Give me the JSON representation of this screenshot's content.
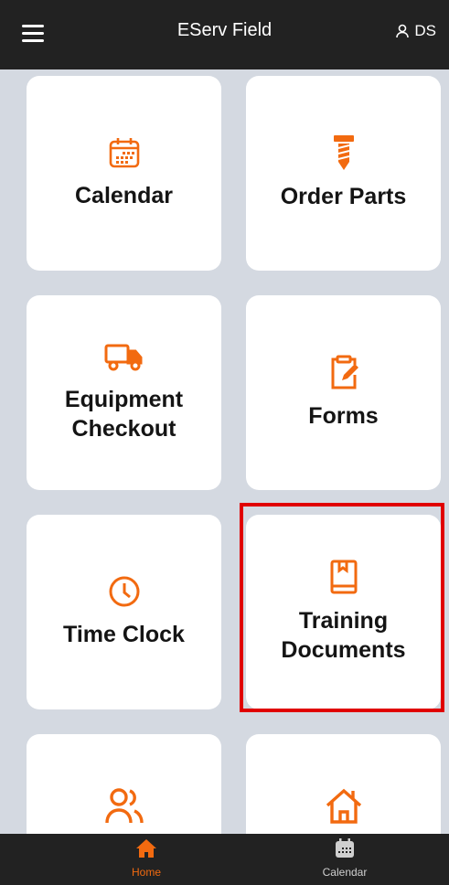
{
  "header": {
    "title": "EServ Field",
    "user_initials": "DS"
  },
  "tiles": [
    {
      "label": "Calendar",
      "icon": "calendar-icon"
    },
    {
      "label": "Order Parts",
      "icon": "screw-icon"
    },
    {
      "label": "Equipment Checkout",
      "icon": "truck-icon"
    },
    {
      "label": "Forms",
      "icon": "clipboard-edit-icon"
    },
    {
      "label": "Time Clock",
      "icon": "clock-icon"
    },
    {
      "label": "Training Documents",
      "icon": "book-icon"
    },
    {
      "label": "",
      "icon": "users-icon"
    },
    {
      "label": "",
      "icon": "home-outline-icon"
    }
  ],
  "bottom_nav": [
    {
      "label": "Home",
      "icon": "home-icon",
      "active": true
    },
    {
      "label": "Calendar",
      "icon": "calendar-icon",
      "active": false
    }
  ],
  "colors": {
    "accent": "#f26a10",
    "bar": "#222222",
    "background": "#d4d9e1",
    "highlight": "#e00000"
  }
}
